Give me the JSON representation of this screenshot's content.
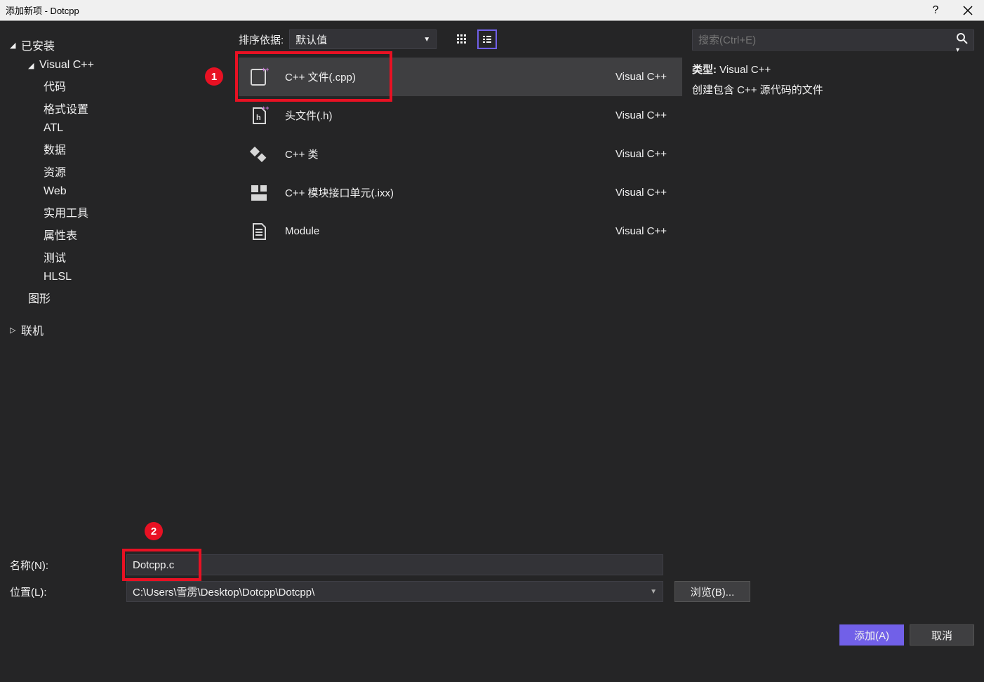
{
  "window": {
    "title": "添加新项 - Dotcpp"
  },
  "sidebar": {
    "installed_label": "已安装",
    "vcpp_label": "Visual C++",
    "items": [
      "代码",
      "格式设置",
      "ATL",
      "数据",
      "资源",
      "Web",
      "实用工具",
      "属性表",
      "测试",
      "HLSL"
    ],
    "graphics_label": "图形",
    "online_label": "联机"
  },
  "toolbar": {
    "sort_label": "排序依据:",
    "sort_value": "默认值"
  },
  "templates": [
    {
      "name": "C++ 文件(.cpp)",
      "lang": "Visual C++"
    },
    {
      "name": "头文件(.h)",
      "lang": "Visual C++"
    },
    {
      "name": "C++ 类",
      "lang": "Visual C++"
    },
    {
      "name": "C++ 模块接口单元(.ixx)",
      "lang": "Visual C++"
    },
    {
      "name": "Module",
      "lang": "Visual C++"
    }
  ],
  "search": {
    "placeholder": "搜索(Ctrl+E)"
  },
  "details": {
    "type_label": "类型:",
    "type_value": "Visual C++",
    "description": "创建包含 C++ 源代码的文件"
  },
  "fields": {
    "name_label": "名称(N):",
    "name_value": "Dotcpp.c",
    "location_label": "位置(L):",
    "location_value": "C:\\Users\\雪雳\\Desktop\\Dotcpp\\Dotcpp\\",
    "browse_label": "浏览(B)..."
  },
  "footer": {
    "add_label": "添加(A)",
    "cancel_label": "取消"
  },
  "annotations": {
    "badge1": "1",
    "badge2": "2"
  }
}
